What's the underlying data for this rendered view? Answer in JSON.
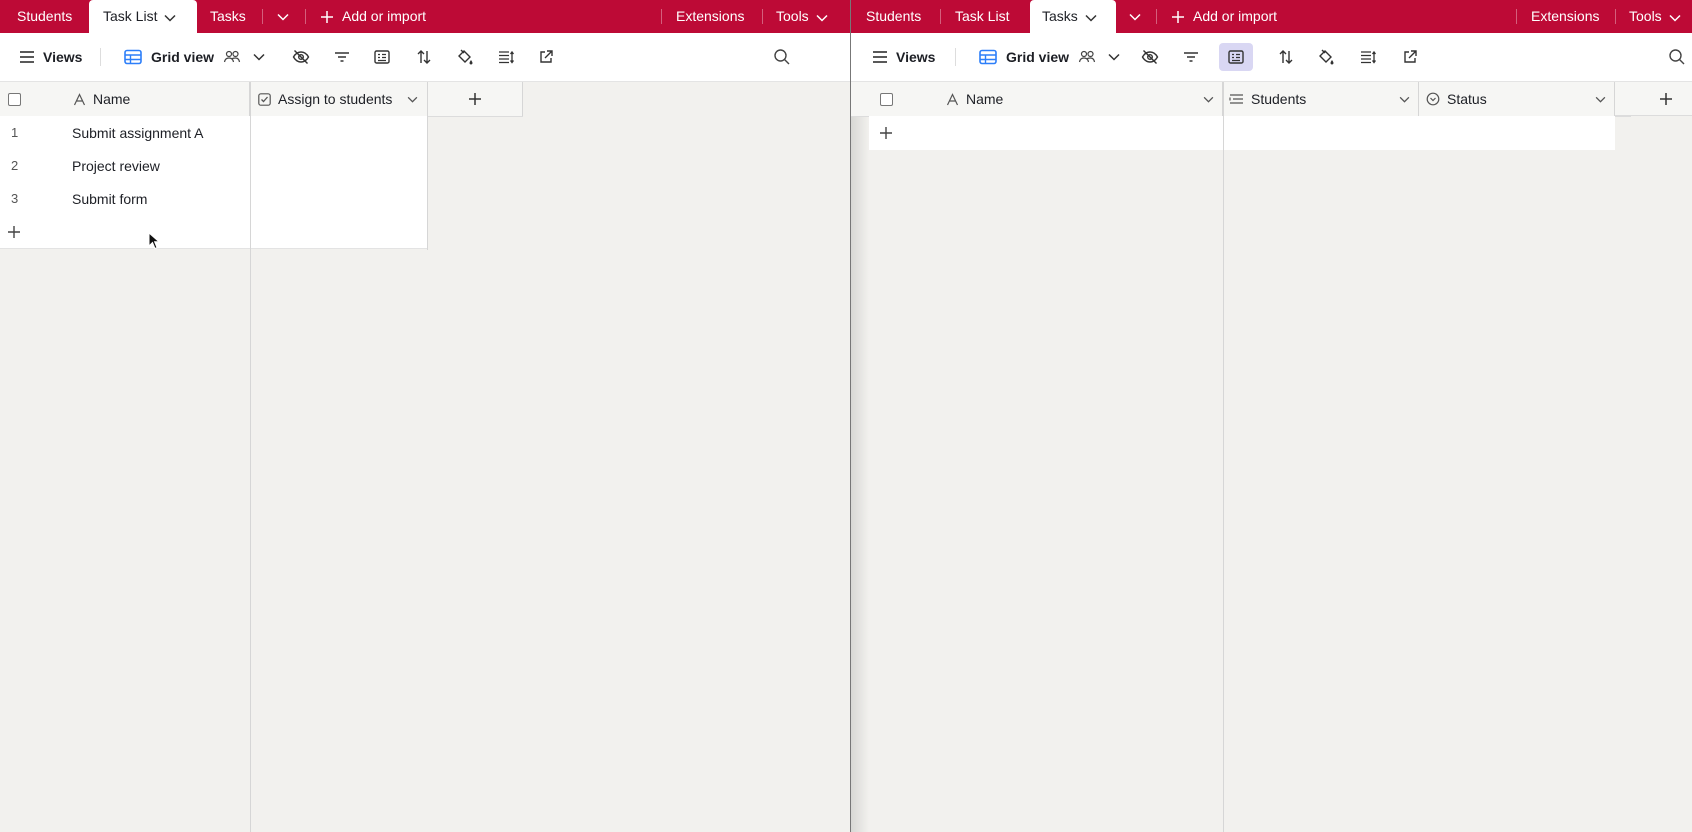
{
  "left": {
    "tabs": {
      "students": "Students",
      "task_list": "Task List",
      "tasks": "Tasks",
      "add_import": "Add or import",
      "extensions": "Extensions",
      "tools": "Tools"
    },
    "toolbar": {
      "views": "Views",
      "grid_view": "Grid view"
    },
    "columns": {
      "name": "Name",
      "assign": "Assign to students"
    },
    "rows": [
      {
        "num": "1",
        "name": "Submit assignment A"
      },
      {
        "num": "2",
        "name": "Project review"
      },
      {
        "num": "3",
        "name": "Submit form"
      }
    ]
  },
  "right": {
    "tabs": {
      "students": "Students",
      "task_list": "Task List",
      "tasks": "Tasks",
      "add_import": "Add or import",
      "extensions": "Extensions",
      "tools": "Tools"
    },
    "toolbar": {
      "views": "Views",
      "grid_view": "Grid view"
    },
    "columns": {
      "name": "Name",
      "students": "Students",
      "status": "Status"
    }
  },
  "colors": {
    "brand": "#bd0a36",
    "highlight": "#d9d7f3",
    "accent": "#2d7ff9"
  }
}
